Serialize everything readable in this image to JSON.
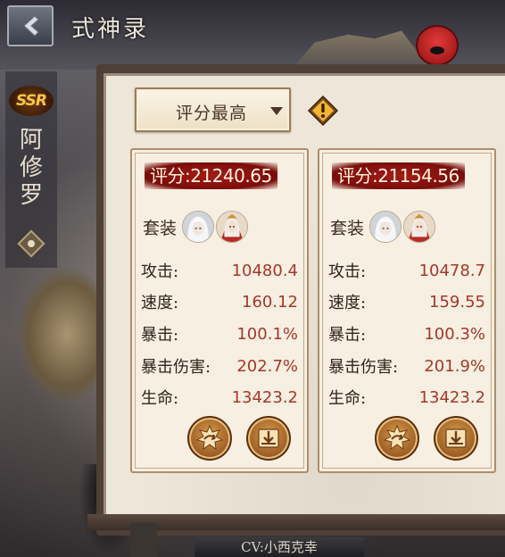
{
  "header": {
    "title": "式神录"
  },
  "shikigami": {
    "rarity": "SSR",
    "name": "阿修罗"
  },
  "sort": {
    "selected": "评分最高"
  },
  "cards": [
    {
      "score": "评分:21240.65",
      "set_label": "套装",
      "stats": [
        {
          "name": "攻击:",
          "value": "10480.4"
        },
        {
          "name": "速度:",
          "value": "160.12"
        },
        {
          "name": "暴击:",
          "value": "100.1%"
        },
        {
          "name": "暴击伤害:",
          "value": "202.7%"
        },
        {
          "name": "生命:",
          "value": "13423.2"
        }
      ]
    },
    {
      "score": "评分:21154.56",
      "set_label": "套装",
      "stats": [
        {
          "name": "攻击:",
          "value": "10478.7"
        },
        {
          "name": "速度:",
          "value": "159.55"
        },
        {
          "name": "暴击:",
          "value": "100.3%"
        },
        {
          "name": "暴击伤害:",
          "value": "201.9%"
        },
        {
          "name": "生命:",
          "value": "13423.2"
        }
      ]
    }
  ],
  "footer": {
    "cv_text": "CV:小西克幸"
  },
  "colors": {
    "score_badge": "#8e120e",
    "stat_value": "#a6382a",
    "card_bg": "#f6efe2",
    "panel_frame": "#4e3f37"
  },
  "icons": {
    "back": "chevron-left-icon",
    "info": "exclamation-diamond-icon",
    "equip": "leaf-swap-icon",
    "apply": "download-tray-icon"
  }
}
